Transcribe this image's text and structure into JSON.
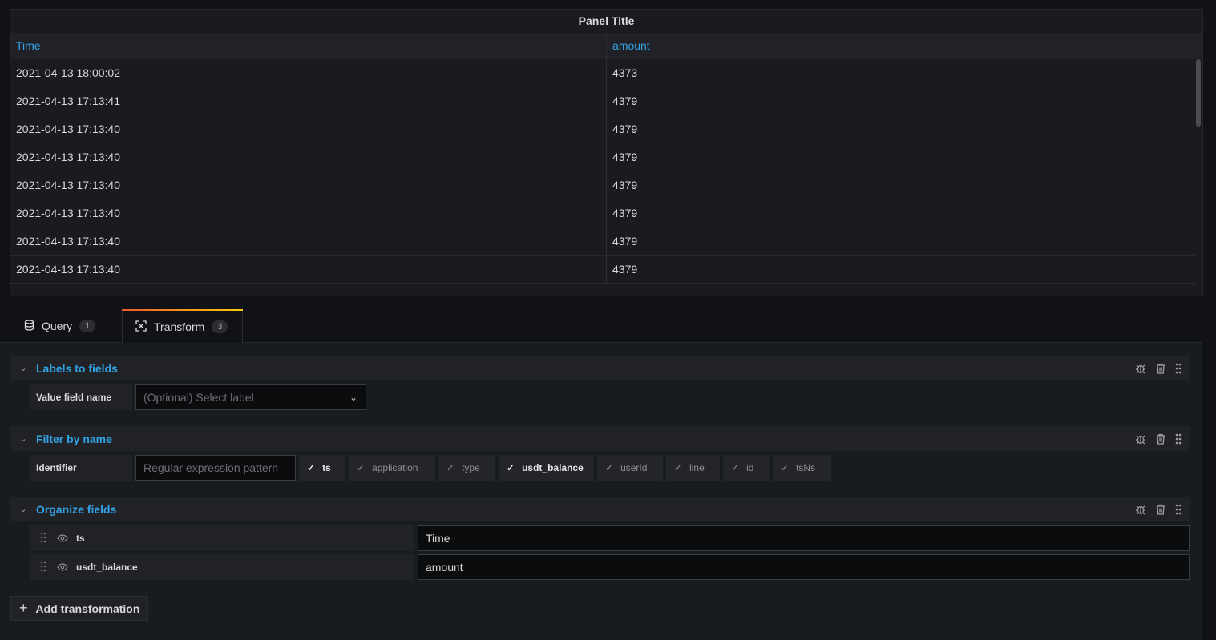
{
  "panel": {
    "title": "Panel Title",
    "columns": [
      "Time",
      "amount"
    ],
    "rows": [
      [
        "2021-04-13 18:00:02",
        "4373"
      ],
      [
        "2021-04-13 17:13:41",
        "4379"
      ],
      [
        "2021-04-13 17:13:40",
        "4379"
      ],
      [
        "2021-04-13 17:13:40",
        "4379"
      ],
      [
        "2021-04-13 17:13:40",
        "4379"
      ],
      [
        "2021-04-13 17:13:40",
        "4379"
      ],
      [
        "2021-04-13 17:13:40",
        "4379"
      ],
      [
        "2021-04-13 17:13:40",
        "4379"
      ]
    ]
  },
  "tabs": [
    {
      "label": "Query",
      "count": "1",
      "icon": "database-icon"
    },
    {
      "label": "Transform",
      "count": "3",
      "icon": "transform-icon"
    }
  ],
  "transforms": {
    "labels_to_fields": {
      "title": "Labels to fields",
      "field_label": "Value field name",
      "select_placeholder": "(Optional) Select label"
    },
    "filter_by_name": {
      "title": "Filter by name",
      "field_label": "Identifier",
      "input_placeholder": "Regular expression pattern",
      "chips": [
        {
          "label": "ts",
          "selected": true
        },
        {
          "label": "application",
          "selected": false
        },
        {
          "label": "type",
          "selected": false
        },
        {
          "label": "usdt_balance",
          "selected": true
        },
        {
          "label": "userId",
          "selected": false
        },
        {
          "label": "line",
          "selected": false
        },
        {
          "label": "id",
          "selected": false
        },
        {
          "label": "tsNs",
          "selected": false
        }
      ]
    },
    "organize_fields": {
      "title": "Organize fields",
      "fields": [
        {
          "name": "ts",
          "rename": "Time"
        },
        {
          "name": "usdt_balance",
          "rename": "amount"
        }
      ]
    }
  },
  "add_transformation_label": "Add transformation",
  "colors": {
    "accent_link": "#33a2e5",
    "tab_gradient_start": "#f05a28",
    "tab_gradient_end": "#fbca0a",
    "background": "#111217"
  }
}
